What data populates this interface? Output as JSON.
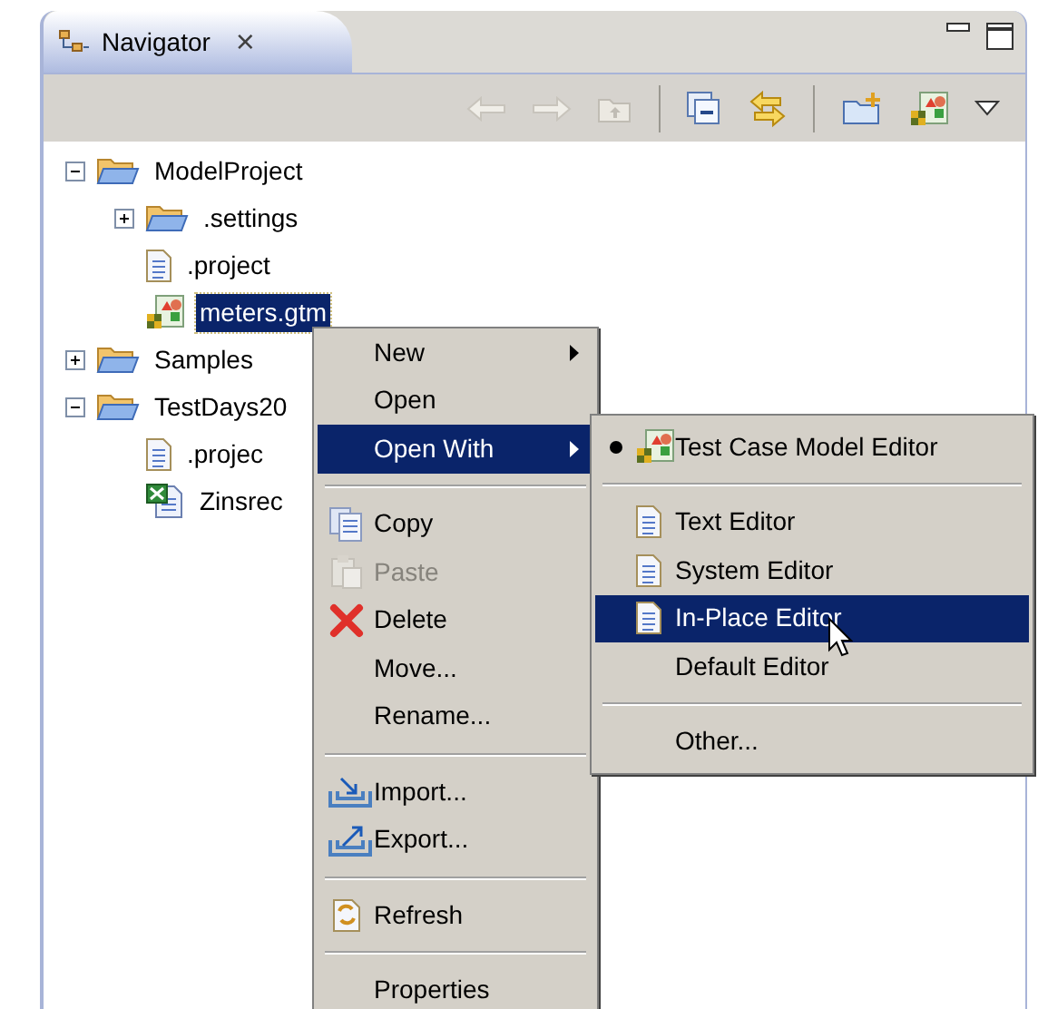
{
  "view": {
    "title": "Navigator",
    "close": "×"
  },
  "tree": [
    {
      "label": "ModelProject",
      "kind": "folder",
      "expanded": true,
      "selected": false,
      "children": [
        {
          "label": ".settings",
          "kind": "folder",
          "expanded": false,
          "selected": false
        },
        {
          "label": ".project",
          "kind": "file",
          "selected": false
        },
        {
          "label": "meters.gtm",
          "kind": "model",
          "selected": true
        }
      ]
    },
    {
      "label": "Samples",
      "kind": "folder",
      "expanded": false,
      "selected": false
    },
    {
      "label": "TestDays20",
      "kind": "folder",
      "expanded": true,
      "selected": false,
      "children": [
        {
          "label": ".projec",
          "kind": "file",
          "selected": false
        },
        {
          "label": "Zinsrec",
          "kind": "sheet",
          "selected": false
        }
      ]
    }
  ],
  "context_menu": [
    {
      "kind": "item",
      "label": "New",
      "submenu": true,
      "selected": false,
      "disabled": false
    },
    {
      "kind": "item",
      "label": "Open",
      "submenu": false,
      "selected": false,
      "disabled": false
    },
    {
      "kind": "item",
      "label": "Open With",
      "submenu": true,
      "selected": true,
      "disabled": false
    },
    {
      "kind": "separator"
    },
    {
      "kind": "item",
      "label": "Copy",
      "submenu": false,
      "selected": false,
      "disabled": false
    },
    {
      "kind": "item",
      "label": "Paste",
      "submenu": false,
      "selected": false,
      "disabled": true
    },
    {
      "kind": "item",
      "label": "Delete",
      "submenu": false,
      "selected": false,
      "disabled": false
    },
    {
      "kind": "item",
      "label": "Move...",
      "submenu": false,
      "selected": false,
      "disabled": false
    },
    {
      "kind": "item",
      "label": "Rename...",
      "submenu": false,
      "selected": false,
      "disabled": false
    },
    {
      "kind": "separator"
    },
    {
      "kind": "item",
      "label": "Import...",
      "submenu": false,
      "selected": false,
      "disabled": false
    },
    {
      "kind": "item",
      "label": "Export...",
      "submenu": false,
      "selected": false,
      "disabled": false
    },
    {
      "kind": "separator"
    },
    {
      "kind": "item",
      "label": "Refresh",
      "submenu": false,
      "selected": false,
      "disabled": false
    },
    {
      "kind": "separator"
    },
    {
      "kind": "item",
      "label": "Properties",
      "submenu": false,
      "selected": false,
      "disabled": false
    }
  ],
  "open_with_menu": [
    {
      "kind": "item",
      "label": "Test Case Model Editor",
      "checked": true,
      "selected": false
    },
    {
      "kind": "separator"
    },
    {
      "kind": "item",
      "label": "Text Editor",
      "checked": false,
      "selected": false
    },
    {
      "kind": "item",
      "label": "System Editor",
      "checked": false,
      "selected": false
    },
    {
      "kind": "item",
      "label": "In-Place Editor",
      "checked": false,
      "selected": true
    },
    {
      "kind": "item",
      "label": "Default Editor",
      "checked": false,
      "selected": false
    },
    {
      "kind": "separator"
    },
    {
      "kind": "item",
      "label": "Other...",
      "checked": false,
      "selected": false
    }
  ]
}
